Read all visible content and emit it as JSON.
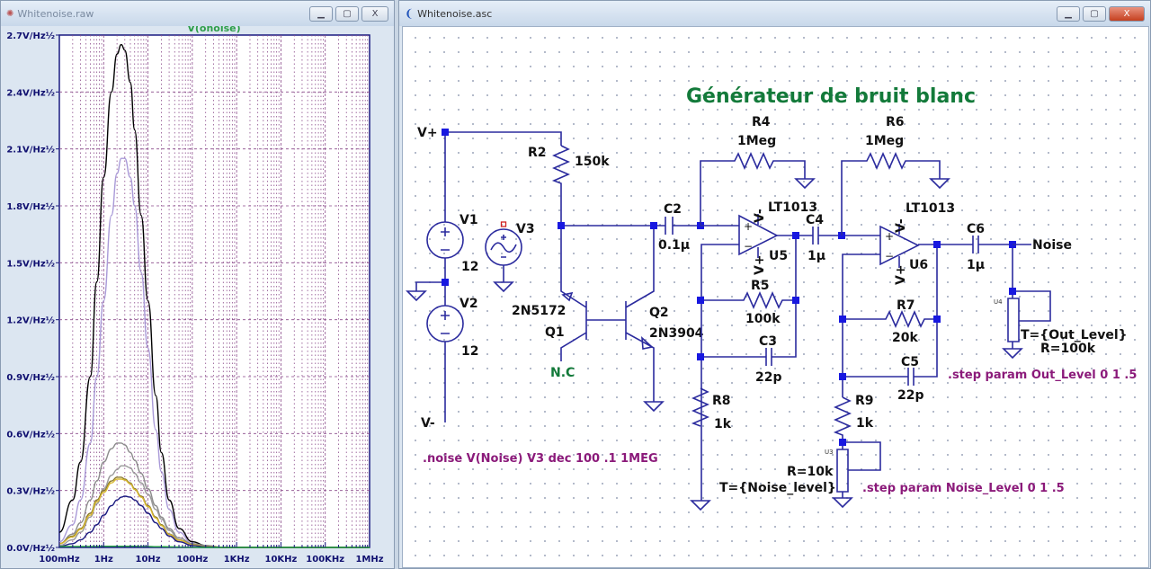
{
  "plot_window": {
    "title": "Whitenoise.raw",
    "trace_label": "V(onoise)",
    "trace_color": "#2e9e4a"
  },
  "schematic_window": {
    "title": "Whitenoise.asc"
  },
  "window_controls": {
    "minimize": "▁",
    "maximize": "▢",
    "close": "X"
  },
  "chart_data": {
    "type": "line",
    "title": "V(onoise)",
    "x_scale": "log",
    "xlim": [
      0.1,
      1000000
    ],
    "ylim": [
      0,
      2.7
    ],
    "xticks": [
      {
        "v": 0.1,
        "label": "100mHz"
      },
      {
        "v": 1,
        "label": "1Hz"
      },
      {
        "v": 10,
        "label": "10Hz"
      },
      {
        "v": 100,
        "label": "100Hz"
      },
      {
        "v": 1000,
        "label": "1KHz"
      },
      {
        "v": 10000,
        "label": "10KHz"
      },
      {
        "v": 100000,
        "label": "100KHz"
      },
      {
        "v": 1000000,
        "label": "1MHz"
      }
    ],
    "yticks": [
      {
        "v": 0,
        "label": "0.0V/Hz½"
      },
      {
        "v": 0.3,
        "label": "0.3V/Hz½"
      },
      {
        "v": 0.6,
        "label": "0.6V/Hz½"
      },
      {
        "v": 0.9,
        "label": "0.9V/Hz½"
      },
      {
        "v": 1.2,
        "label": "1.2V/Hz½"
      },
      {
        "v": 1.5,
        "label": "1.5V/Hz½"
      },
      {
        "v": 1.8,
        "label": "1.8V/Hz½"
      },
      {
        "v": 2.1,
        "label": "2.1V/Hz½"
      },
      {
        "v": 2.4,
        "label": "2.4V/Hz½"
      },
      {
        "v": 2.7,
        "label": "2.7V/Hz½"
      }
    ],
    "grid": true,
    "x": [
      0.1,
      0.2,
      0.3,
      0.5,
      0.7,
      1,
      1.5,
      2,
      2.5,
      3,
      4,
      5,
      7,
      10,
      15,
      20,
      30,
      50,
      100,
      200,
      500,
      1000,
      10000,
      100000,
      1000000
    ],
    "series": [
      {
        "color": "#000000",
        "values": [
          0.08,
          0.25,
          0.45,
          0.9,
          1.4,
          1.95,
          2.4,
          2.6,
          2.65,
          2.62,
          2.45,
          2.2,
          1.75,
          1.3,
          0.8,
          0.5,
          0.25,
          0.1,
          0.03,
          0.01,
          0,
          0,
          0,
          0,
          0
        ]
      },
      {
        "color": "#a99ad8",
        "values": [
          0.03,
          0.12,
          0.25,
          0.55,
          0.9,
          1.3,
          1.75,
          1.97,
          2.05,
          2.05,
          1.95,
          1.8,
          1.45,
          1.05,
          0.62,
          0.4,
          0.2,
          0.08,
          0.02,
          0.01,
          0,
          0,
          0,
          0,
          0
        ]
      },
      {
        "color": "#8c8c8c",
        "values": [
          0.02,
          0.07,
          0.13,
          0.25,
          0.35,
          0.45,
          0.52,
          0.55,
          0.55,
          0.54,
          0.5,
          0.46,
          0.39,
          0.31,
          0.22,
          0.16,
          0.1,
          0.05,
          0.02,
          0.01,
          0,
          0,
          0,
          0,
          0
        ]
      },
      {
        "color": "#9a9a9a",
        "values": [
          0.01,
          0.04,
          0.08,
          0.16,
          0.23,
          0.31,
          0.38,
          0.41,
          0.43,
          0.43,
          0.42,
          0.39,
          0.34,
          0.28,
          0.2,
          0.15,
          0.09,
          0.04,
          0.015,
          0.005,
          0,
          0,
          0,
          0,
          0
        ]
      },
      {
        "color": "#8a7a2a",
        "values": [
          0.02,
          0.06,
          0.1,
          0.18,
          0.25,
          0.3,
          0.35,
          0.37,
          0.37,
          0.36,
          0.34,
          0.31,
          0.27,
          0.22,
          0.16,
          0.12,
          0.07,
          0.04,
          0.015,
          0.005,
          0,
          0,
          0,
          0,
          0
        ]
      },
      {
        "color": "#d8b830",
        "values": [
          0.02,
          0.055,
          0.095,
          0.17,
          0.24,
          0.29,
          0.34,
          0.36,
          0.36,
          0.355,
          0.335,
          0.305,
          0.265,
          0.215,
          0.155,
          0.115,
          0.068,
          0.038,
          0.014,
          0.005,
          0,
          0,
          0,
          0,
          0
        ]
      },
      {
        "color": "#1a1a80",
        "values": [
          0.005,
          0.02,
          0.04,
          0.08,
          0.12,
          0.17,
          0.22,
          0.25,
          0.265,
          0.27,
          0.265,
          0.25,
          0.22,
          0.18,
          0.13,
          0.1,
          0.06,
          0.03,
          0.01,
          0.003,
          0,
          0,
          0,
          0,
          0
        ]
      },
      {
        "color": "#20a040",
        "values": [
          0.005,
          0.005,
          0.005,
          0.005,
          0.005,
          0.006,
          0.006,
          0.006,
          0.006,
          0.006,
          0.006,
          0.006,
          0.005,
          0.005,
          0.004,
          0.004,
          0.003,
          0.002,
          0.001,
          0,
          0,
          0,
          0,
          0,
          0
        ]
      }
    ]
  },
  "schematic": {
    "title": "Générateur de bruit blanc",
    "title_color": "#137a3a",
    "nets": {
      "vplus": "V+",
      "vminus": "V-",
      "noise": "Noise",
      "nc": "N.C"
    },
    "V1": {
      "name": "V1",
      "value": "12"
    },
    "V2": {
      "name": "V2",
      "value": "12"
    },
    "V3": {
      "name": "V3"
    },
    "R2": {
      "name": "R2",
      "value": "150k"
    },
    "R4": {
      "name": "R4",
      "value": "1Meg"
    },
    "R5": {
      "name": "R5",
      "value": "100k"
    },
    "R6": {
      "name": "R6",
      "value": "1Meg"
    },
    "R7": {
      "name": "R7",
      "value": "20k"
    },
    "R8": {
      "name": "R8",
      "value": "1k"
    },
    "R9": {
      "name": "R9",
      "value": "1k"
    },
    "C2": {
      "name": "C2",
      "value": "0.1µ"
    },
    "C3": {
      "name": "C3",
      "value": "22p"
    },
    "C4": {
      "name": "C4",
      "value": "1µ"
    },
    "C5": {
      "name": "C5",
      "value": "22p"
    },
    "C6": {
      "name": "C6",
      "value": "1µ"
    },
    "Q1": {
      "name": "Q1",
      "model": "2N5172"
    },
    "Q2": {
      "name": "Q2",
      "model": "2N3904"
    },
    "U5": {
      "name": "U5",
      "model": "LT1013"
    },
    "U6": {
      "name": "U6",
      "model": "LT1013"
    },
    "U3": {
      "name": "U3",
      "r": "R=10k",
      "t": "T={Noise_level}"
    },
    "U4": {
      "name": "U4",
      "r": "R=100k",
      "t": "T={Out_Level}"
    },
    "pins": {
      "vminus": "V-",
      "vplus": "V+",
      "plus": "+",
      "minus": "−"
    },
    "directives": {
      "noise": ".noise V(Noise) V3 dec 100 .1 1MEG",
      "step_noise": ".step param Noise_Level 0 1 .5",
      "step_out": ".step param Out_Level 0 1 .5"
    }
  }
}
